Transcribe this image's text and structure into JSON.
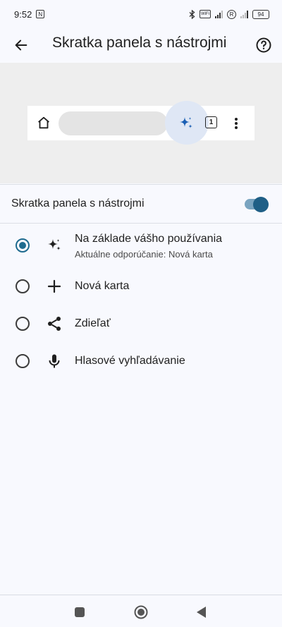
{
  "status_bar": {
    "time": "9:52",
    "battery": "94",
    "vowifi_label": "Vo WiFi",
    "r_badge": "R"
  },
  "header": {
    "title": "Skratka panela s nástrojmi",
    "back_icon": "arrow-back-icon",
    "help_icon": "help-circle-icon"
  },
  "preview": {
    "tab_count": "1",
    "icons": [
      "home-icon",
      "sparkle-icon",
      "tab-switcher-icon",
      "more-vert-icon"
    ]
  },
  "toggle": {
    "label": "Skratka panela s nástrojmi",
    "enabled": true
  },
  "options": [
    {
      "icon": "sparkle-icon",
      "title": "Na základe vášho používania",
      "subtitle": "Aktuálne odporúčanie: Nová karta",
      "selected": true
    },
    {
      "icon": "plus-icon",
      "title": "Nová karta",
      "subtitle": "",
      "selected": false
    },
    {
      "icon": "share-icon",
      "title": "Zdieľať",
      "subtitle": "",
      "selected": false
    },
    {
      "icon": "mic-icon",
      "title": "Hlasové vyhľadávanie",
      "subtitle": "",
      "selected": false
    }
  ],
  "colors": {
    "accent": "#1f6b8f",
    "highlight": "#dfe7f5",
    "sparkle": "#1a5fb4",
    "background": "#f8f9fe",
    "preview_bg": "#eeeeee"
  },
  "nav_bar": {
    "icons": [
      "recents-square-icon",
      "home-circle-icon",
      "back-triangle-icon"
    ]
  }
}
